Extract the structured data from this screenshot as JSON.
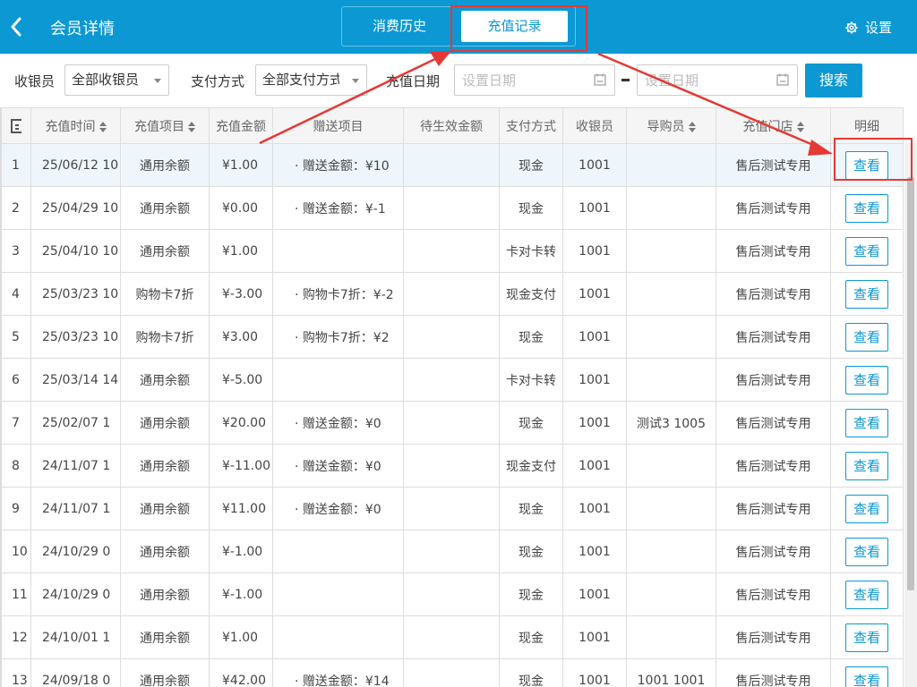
{
  "header": {
    "back_icon": "chevron-left-icon",
    "title": "会员详情",
    "tabs": [
      {
        "label": "消费历史",
        "active": false
      },
      {
        "label": "充值记录",
        "active": true
      }
    ],
    "settings_icon": "gear-icon",
    "settings_label": "设置",
    "color": "#0b98d3"
  },
  "filters": {
    "cashier_label": "收银员",
    "cashier_value": "全部收银员",
    "payment_label": "支付方式",
    "payment_value": "全部支付方式",
    "date_label": "充值日期",
    "date_start_placeholder": "设置日期",
    "date_end_placeholder": "设置日期",
    "date_separator": "-",
    "search_label": "搜索"
  },
  "table": {
    "columns": [
      {
        "label": "",
        "sortable": false
      },
      {
        "label": "充值时间",
        "sortable": true
      },
      {
        "label": "充值项目",
        "sortable": true
      },
      {
        "label": "充值金额",
        "sortable": false
      },
      {
        "label": "赠送项目",
        "sortable": false
      },
      {
        "label": "待生效金额",
        "sortable": false
      },
      {
        "label": "支付方式",
        "sortable": false
      },
      {
        "label": "收银员",
        "sortable": false
      },
      {
        "label": "导购员",
        "sortable": true
      },
      {
        "label": "充值门店",
        "sortable": true
      },
      {
        "label": "明细",
        "sortable": false
      }
    ],
    "view_label": "查看",
    "rows": [
      {
        "idx": "1",
        "time": "25/06/12 10",
        "item": "通用余额",
        "amount": "¥1.00",
        "gift": "· 赠送金额：¥10",
        "pending": "",
        "payment": "现金",
        "cashier": "1001",
        "guide": "",
        "store": "售后测试专用"
      },
      {
        "idx": "2",
        "time": "25/04/29 10",
        "item": "通用余额",
        "amount": "¥0.00",
        "gift": "· 赠送金额：¥-1",
        "pending": "",
        "payment": "现金",
        "cashier": "1001",
        "guide": "",
        "store": "售后测试专用"
      },
      {
        "idx": "3",
        "time": "25/04/10 10",
        "item": "通用余额",
        "amount": "¥1.00",
        "gift": "",
        "pending": "",
        "payment": "卡对卡转",
        "cashier": "1001",
        "guide": "",
        "store": "售后测试专用"
      },
      {
        "idx": "4",
        "time": "25/03/23 10",
        "item": "购物卡7折",
        "amount": "¥-3.00",
        "gift": "· 购物卡7折：¥-2",
        "pending": "",
        "payment": "现金支付",
        "cashier": "1001",
        "guide": "",
        "store": "售后测试专用"
      },
      {
        "idx": "5",
        "time": "25/03/23 10",
        "item": "购物卡7折",
        "amount": "¥3.00",
        "gift": "· 购物卡7折：¥2",
        "pending": "",
        "payment": "现金",
        "cashier": "1001",
        "guide": "",
        "store": "售后测试专用"
      },
      {
        "idx": "6",
        "time": "25/03/14 14",
        "item": "通用余额",
        "amount": "¥-5.00",
        "gift": "",
        "pending": "",
        "payment": "卡对卡转",
        "cashier": "1001",
        "guide": "",
        "store": "售后测试专用"
      },
      {
        "idx": "7",
        "time": "25/02/07 1",
        "item": "通用余额",
        "amount": "¥20.00",
        "gift": "· 赠送金额：¥0",
        "pending": "",
        "payment": "现金",
        "cashier": "1001",
        "guide": "测试3 1005",
        "store": "售后测试专用"
      },
      {
        "idx": "8",
        "time": "24/11/07 1",
        "item": "通用余额",
        "amount": "¥-11.00",
        "gift": "· 赠送金额：¥0",
        "pending": "",
        "payment": "现金支付",
        "cashier": "1001",
        "guide": "",
        "store": "售后测试专用"
      },
      {
        "idx": "9",
        "time": "24/11/07 1",
        "item": "通用余额",
        "amount": "¥11.00",
        "gift": "· 赠送金额：¥0",
        "pending": "",
        "payment": "现金",
        "cashier": "1001",
        "guide": "",
        "store": "售后测试专用"
      },
      {
        "idx": "10",
        "time": "24/10/29 0",
        "item": "通用余额",
        "amount": "¥-1.00",
        "gift": "",
        "pending": "",
        "payment": "现金",
        "cashier": "1001",
        "guide": "",
        "store": "售后测试专用"
      },
      {
        "idx": "11",
        "time": "24/10/29 0",
        "item": "通用余额",
        "amount": "¥-1.00",
        "gift": "",
        "pending": "",
        "payment": "现金",
        "cashier": "1001",
        "guide": "",
        "store": "售后测试专用"
      },
      {
        "idx": "12",
        "time": "24/10/01 1",
        "item": "通用余额",
        "amount": "¥1.00",
        "gift": "",
        "pending": "",
        "payment": "现金",
        "cashier": "1001",
        "guide": "",
        "store": "售后测试专用"
      },
      {
        "idx": "13",
        "time": "24/09/18 0",
        "item": "通用余额",
        "amount": "¥42.00",
        "gift": "· 赠送金额：¥14",
        "pending": "",
        "payment": "现金",
        "cashier": "1001",
        "guide": "1001 1001",
        "store": "售后测试专用"
      }
    ]
  }
}
